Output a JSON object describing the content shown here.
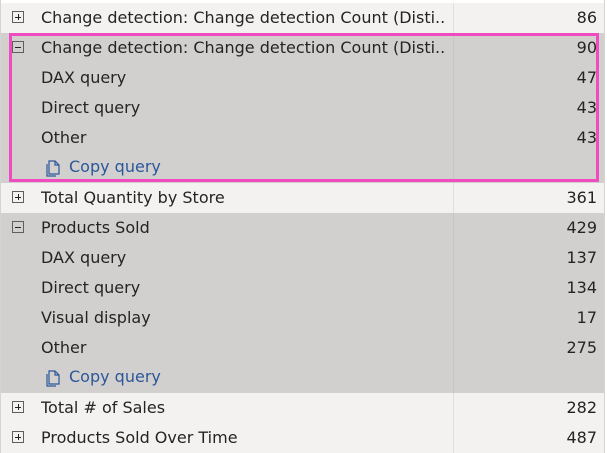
{
  "rows": [
    {
      "label": "Change detection: Change detection Count (Disti...",
      "value": "86"
    },
    {
      "label": "Change detection: Change detection Count (Disti...",
      "value": "90",
      "children": [
        {
          "label": "DAX query",
          "value": "47"
        },
        {
          "label": "Direct query",
          "value": "43"
        },
        {
          "label": "Other",
          "value": "43"
        }
      ],
      "action": "Copy query"
    },
    {
      "label": "Total Quantity by Store",
      "value": "361"
    },
    {
      "label": "Products Sold",
      "value": "429",
      "children": [
        {
          "label": "DAX query",
          "value": "137"
        },
        {
          "label": "Direct query",
          "value": "134"
        },
        {
          "label": "Visual display",
          "value": "17"
        },
        {
          "label": "Other",
          "value": "275"
        }
      ],
      "action": "Copy query"
    },
    {
      "label": "Total # of Sales",
      "value": "282"
    },
    {
      "label": "Products Sold Over Time",
      "value": "487"
    }
  ],
  "icons": {
    "expand": "plus-box-icon",
    "collapse": "minus-box-icon",
    "copy": "copy-icon"
  },
  "colors": {
    "highlight": "#f04bbf",
    "link": "#2b579a",
    "expanded_bg": "#d2d0ce",
    "row_bg": "#f3f2f1"
  }
}
